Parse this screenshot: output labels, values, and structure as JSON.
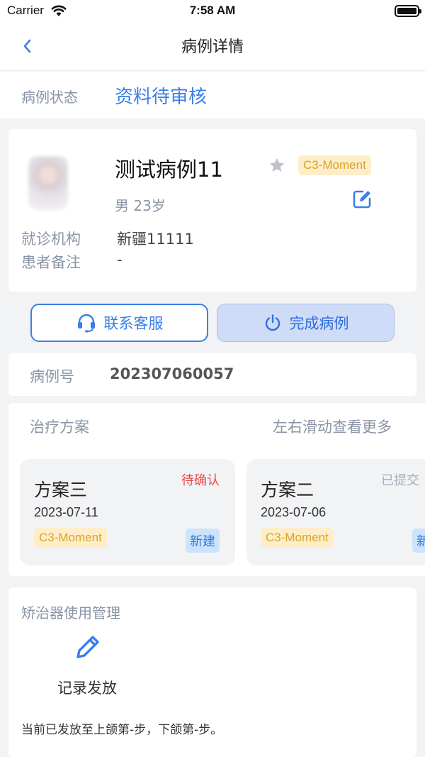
{
  "status_bar": {
    "carrier": "Carrier",
    "time": "7:58 AM"
  },
  "nav": {
    "title": "病例详情"
  },
  "case_status": {
    "label": "病例状态",
    "value": "资料待审核"
  },
  "patient": {
    "name": "测试病例11",
    "tag": "C3-Moment",
    "gender_age": "男   23岁",
    "institution_label": "就诊机构",
    "institution_value": "新疆11111",
    "note_label": "患者备注",
    "note_value": "-"
  },
  "actions": {
    "contact": "联系客服",
    "complete": "完成病例"
  },
  "case_number": {
    "label": "病例号",
    "value": "202307060057"
  },
  "plans": {
    "title": "治疗方案",
    "hint": "左右滑动查看更多",
    "items": [
      {
        "name": "方案三",
        "status": "待确认",
        "status_color": "#e8484a",
        "date": "2023-07-11",
        "tag": "C3-Moment",
        "badge": "新建"
      },
      {
        "name": "方案二",
        "status": "已提交",
        "status_color": "#a8afbc",
        "date": "2023-07-06",
        "tag": "C3-Moment",
        "badge": "新建"
      }
    ]
  },
  "device": {
    "title": "矫治器使用管理",
    "record_label": "记录发放",
    "description": "当前已发放至上颌第-步，下颌第-步。"
  },
  "colors": {
    "accent": "#3a7ee8",
    "tag_yellow_bg": "#fdeec9",
    "tag_yellow_text": "#d8a521",
    "muted": "#8a94a6"
  }
}
